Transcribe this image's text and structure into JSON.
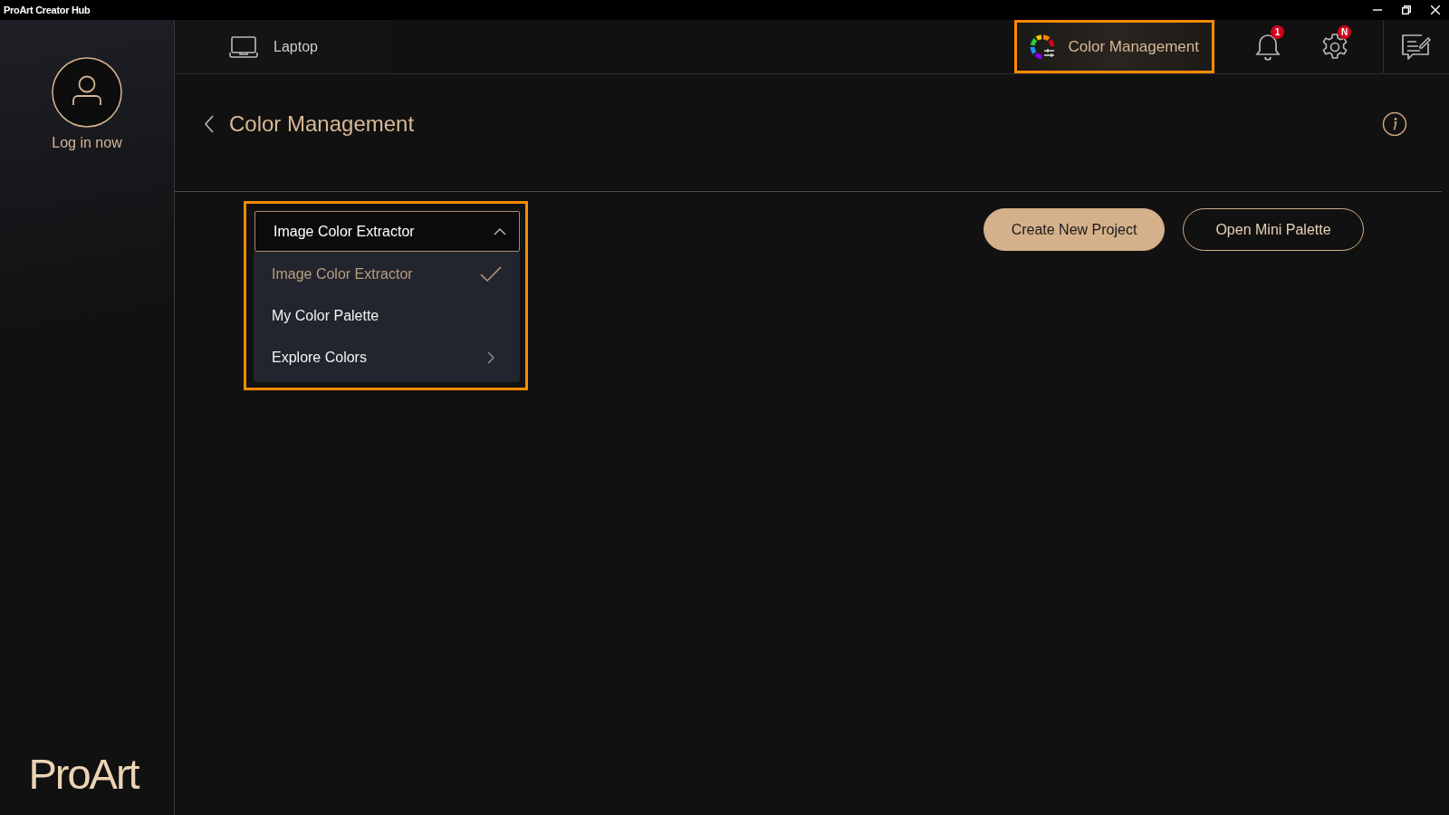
{
  "window": {
    "title": "ProArt Creator Hub"
  },
  "sidebar": {
    "login_label": "Log in now",
    "logo": "ProArt"
  },
  "top_bar": {
    "device_tab": {
      "label": "Laptop"
    },
    "feature_button": {
      "label": "Color Management",
      "highlighted": true
    },
    "notifications": {
      "badge": "1"
    },
    "settings": {
      "badge": "N"
    }
  },
  "page": {
    "title": "Color Management"
  },
  "mode_dropdown": {
    "value": "Image Color Extractor",
    "expanded": true,
    "highlighted": true,
    "options": [
      {
        "label": "Image Color Extractor",
        "selected": true,
        "kind": "plain"
      },
      {
        "label": "My Color Palette",
        "selected": false,
        "kind": "plain"
      },
      {
        "label": "Explore Colors",
        "selected": false,
        "kind": "submenu"
      }
    ]
  },
  "actions": [
    {
      "label": "Create New Project",
      "kind": "primary"
    },
    {
      "label": "Open Mini Palette",
      "kind": "outline"
    }
  ]
}
